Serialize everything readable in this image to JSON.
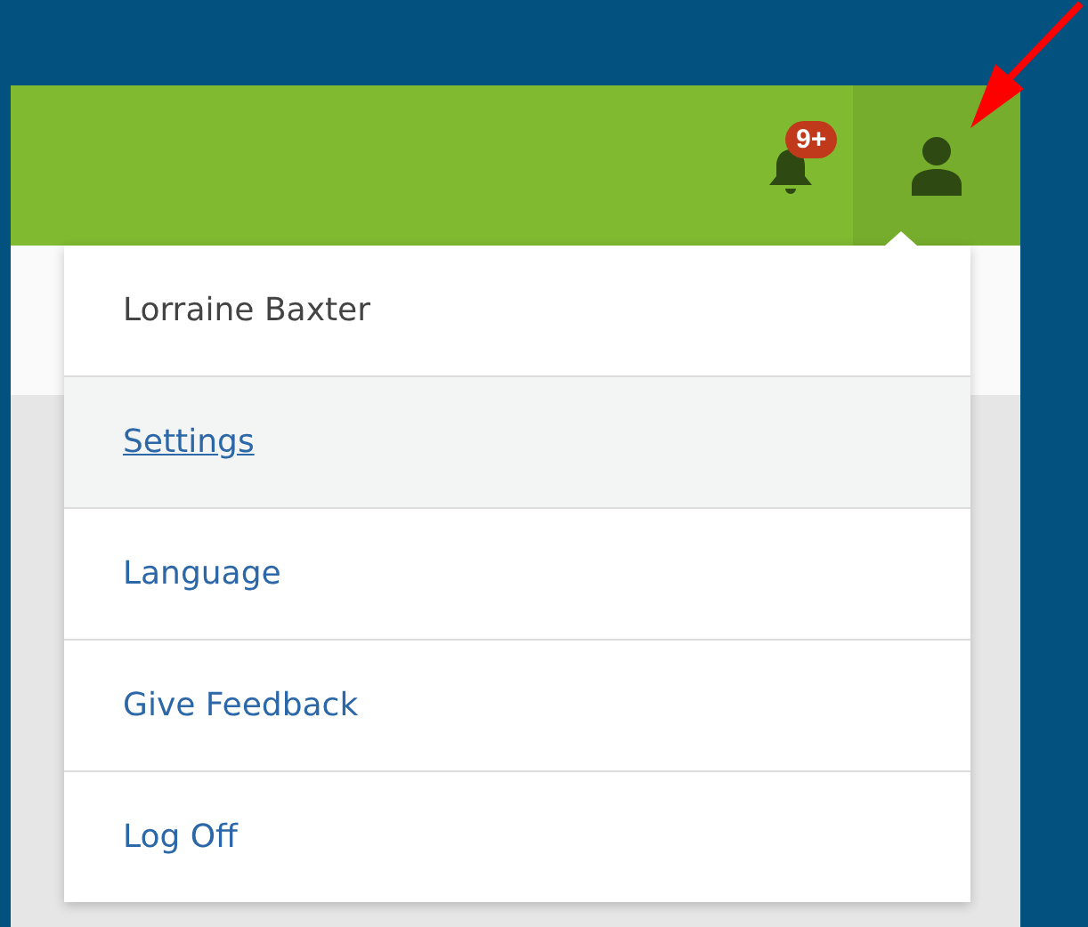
{
  "header": {
    "notification_badge": "9+"
  },
  "user_menu": {
    "items": [
      {
        "label": "Lorraine Baxter",
        "kind": "name",
        "selected": false
      },
      {
        "label": "Settings",
        "kind": "link",
        "selected": true
      },
      {
        "label": "Language",
        "kind": "link",
        "selected": false
      },
      {
        "label": "Give Feedback",
        "kind": "link",
        "selected": false
      },
      {
        "label": "Log Off",
        "kind": "link",
        "selected": false
      }
    ]
  }
}
